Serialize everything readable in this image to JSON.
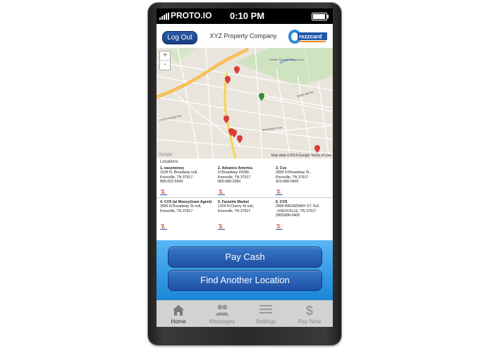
{
  "status_bar": {
    "carrier": "PROTO.IO",
    "time": "0:10 PM"
  },
  "header": {
    "logout_label": "Log Out",
    "company": "XYZ Property Company",
    "brand_text": "rezzcard"
  },
  "map": {
    "zoom_in": "+",
    "zoom_out": "-",
    "credits": "Map data ©2014 Google  Terms of Use",
    "watermark": "Google",
    "labels": [
      "Whittle Springs Golf Course",
      "Chickamauga Ave",
      "Washington Ave",
      "Buffat Mill Rd"
    ]
  },
  "locations": {
    "title": "Locations",
    "items": [
      {
        "name": "1. easymoney",
        "addr1": "3106 N. Broadway null,",
        "addr2": "Knoxville, TN 37917",
        "phone": "865-622-5934"
      },
      {
        "name": "2. Advance America",
        "addr1": "N Broadway 4209b ,",
        "addr2": "Knoxville, TN 37917",
        "phone": "865-689-2990"
      },
      {
        "name": "3. Cvs",
        "addr1": "2800 N Broadway St ,",
        "addr2": "Knoxville, TN 37917",
        "phone": "423-688-0400"
      },
      {
        "name": "4. CVS (at MoneyGram Agent)",
        "addr1": "2800 N Broadway St null,",
        "addr2": "Knoxville, TN 37917",
        "phone": ""
      },
      {
        "name": "5. Favorite Market",
        "addr1": "1324 N Cherry St null,",
        "addr2": "Knoxville, TN 37917",
        "phone": ""
      },
      {
        "name": "6. CVS",
        "addr1": "2800 BROADWAY ST. N.E.",
        "addr2": ", KNOXVILLE, TN 37917",
        "phone": "(865)688-0400"
      }
    ]
  },
  "actions": {
    "pay_cash": "Pay Cash",
    "find_location": "Find Another Location"
  },
  "tabs": [
    {
      "label": "Home",
      "icon": "home-icon"
    },
    {
      "label": "Messages",
      "icon": "people-icon"
    },
    {
      "label": "Settings",
      "icon": "menu-icon"
    },
    {
      "label": "Pay Now",
      "icon": "dollar-icon"
    }
  ]
}
